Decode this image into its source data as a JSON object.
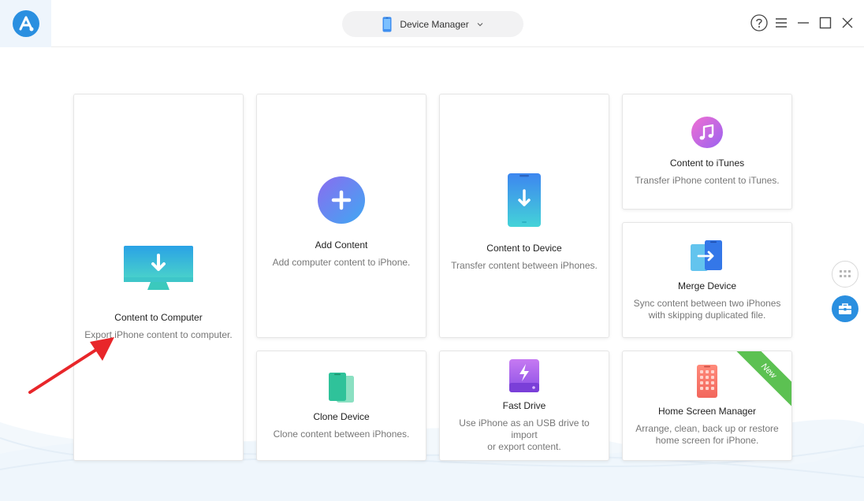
{
  "header": {
    "device_selector_label": "Device Manager"
  },
  "cards": {
    "content_to_computer": {
      "title": "Content to Computer",
      "desc": "Export iPhone content to computer."
    },
    "add_content": {
      "title": "Add Content",
      "desc": "Add computer content to iPhone."
    },
    "content_to_device": {
      "title": "Content to Device",
      "desc": "Transfer content between iPhones."
    },
    "content_to_itunes": {
      "title": "Content to iTunes",
      "desc": "Transfer iPhone content to iTunes."
    },
    "merge_device": {
      "title": "Merge Device",
      "desc_line1": "Sync content between two iPhones",
      "desc_line2": "with skipping duplicated file."
    },
    "clone_device": {
      "title": "Clone Device",
      "desc": "Clone content between iPhones."
    },
    "fast_drive": {
      "title": "Fast Drive",
      "desc_line1": "Use iPhone as an USB drive to import",
      "desc_line2": "or export content."
    },
    "home_screen_manager": {
      "title": "Home Screen Manager",
      "desc_line1": "Arrange, clean, back up or restore",
      "desc_line2": "home screen for iPhone.",
      "badge": "New"
    }
  },
  "icons": {
    "logo": "app-logo-icon",
    "help": "help-icon",
    "menu": "menu-icon",
    "minimize": "minimize-icon",
    "maximize": "maximize-icon",
    "close": "close-icon"
  },
  "colors": {
    "accent_blue": "#2a8fe0",
    "badge_green": "#5cc152",
    "arrow_red": "#e8262a"
  }
}
